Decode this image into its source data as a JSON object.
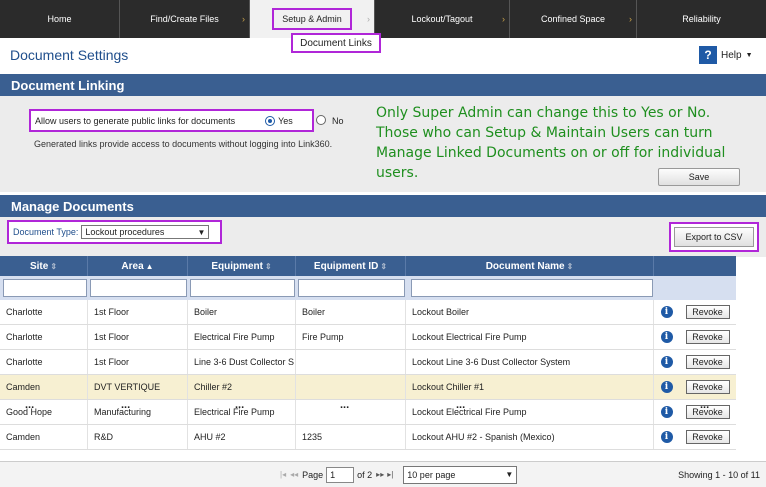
{
  "nav": {
    "tabs": [
      "Home",
      "Find/Create Files",
      "Setup & Admin",
      "Lockout/Tagout",
      "Confined Space",
      "Reliability"
    ],
    "active_tab": "Setup & Admin",
    "submenu_item": "Document Links"
  },
  "page": {
    "title": "Document Settings",
    "help_label": "Help",
    "help_icon_glyph": "?"
  },
  "linking": {
    "section_title": "Document Linking",
    "allow_label": "Allow users to generate public links for documents",
    "yes_label": "Yes",
    "no_label": "No",
    "selected": "Yes",
    "note": "Generated links provide access to documents without logging into Link360.",
    "annotation_lines": [
      "Only Super Admin can change this to Yes or No.",
      "Those who can Setup & Maintain Users can turn",
      "Manage Linked Documents on or off for individual users."
    ],
    "save_label": "Save"
  },
  "manage": {
    "section_title": "Manage Documents",
    "doctype_label": "Document Type:",
    "doctype_value": "Lockout procedures",
    "export_label": "Export to CSV",
    "columns": [
      "Site",
      "Area",
      "Equipment",
      "Equipment ID",
      "Document Name"
    ],
    "rows": [
      {
        "site": "Charlotte",
        "area": "1st Floor",
        "equipment": "Boiler",
        "equipment_id": "Boiler",
        "document": "Lockout Boiler"
      },
      {
        "site": "Charlotte",
        "area": "1st Floor",
        "equipment": "Electrical Fire Pump",
        "equipment_id": "Fire Pump",
        "document": "Lockout Electrical Fire Pump"
      },
      {
        "site": "Charlotte",
        "area": "1st Floor",
        "equipment": "Line 3-6 Dust Collector S",
        "equipment_id": "",
        "document": "Lockout Line 3-6 Dust Collector System"
      },
      {
        "site": "Camden",
        "area": "DVT VERTIQUE",
        "equipment": "Chiller #2",
        "equipment_id": "",
        "document": "Lockout Chiller #1"
      },
      {
        "site": "Good Hope",
        "area": "Manufacturing",
        "equipment": "Electrical Fire Pump",
        "equipment_id": "",
        "document": "Lockout Electrical Fire Pump"
      },
      {
        "site": "Camden",
        "area": "R&D",
        "equipment": "AHU #2",
        "equipment_id": "1235",
        "document": "Lockout AHU #2 - Spanish (Mexico)"
      }
    ],
    "revoke_label": "Revoke",
    "ellipsis": "..."
  },
  "pager": {
    "page_label": "Page",
    "page_value": "1",
    "of_label": "of 2",
    "per_page": "10 per page",
    "showing": "Showing 1 - 10 of 11"
  },
  "colors": {
    "nav_bg": "#2b2b2b",
    "section_bar": "#3a5f91",
    "highlight": "#b026d8",
    "annotation": "#1f8f1f"
  }
}
